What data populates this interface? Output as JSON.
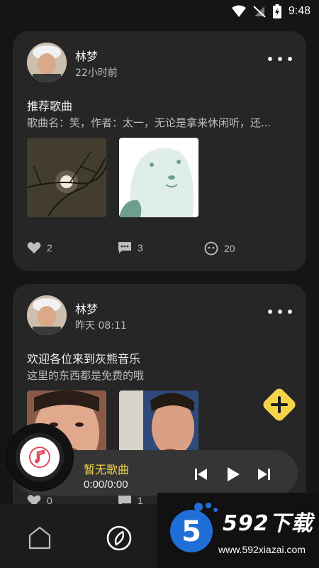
{
  "status_bar": {
    "time": "9:48"
  },
  "posts": [
    {
      "author": "林梦",
      "time": "22小时前",
      "title": "推荐歌曲",
      "description": "歌曲名：笑，作者：太一，无论是拿来休闲听，还...",
      "likes": "2",
      "comments": "3",
      "views": "20"
    },
    {
      "author": "林梦",
      "time": "昨天 08:11",
      "title": "欢迎各位来到灰熊音乐",
      "description": "这里的东西都是免费的哦",
      "likes": "0",
      "comments": "1"
    }
  ],
  "player": {
    "song_title": "暂无歌曲",
    "progress": "0:00/0:00"
  },
  "watermark": {
    "title": "592下载",
    "logo_digit": "5",
    "url": "www.592xiazai.com"
  },
  "colors": {
    "accent_yellow": "#f7d34a",
    "card_bg": "#262626",
    "page_bg": "#151515"
  }
}
